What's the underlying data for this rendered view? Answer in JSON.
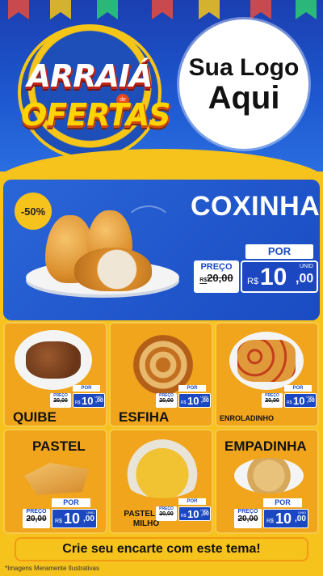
{
  "header": {
    "badge_line1": "ARRAIÁ",
    "badge_small": "de",
    "badge_line2": "OFERTAS",
    "logo_line1": "Sua Logo",
    "logo_line2": "Aqui"
  },
  "hero": {
    "discount": "-50%",
    "title": "COXINHA",
    "por": "POR",
    "preco_label": "PREÇO",
    "old_price": "20,00",
    "old_currency": "R$",
    "currency": "R$",
    "price_int": "10",
    "price_cents": ",00",
    "unit": "UNID"
  },
  "products": [
    {
      "name": "QUIBE",
      "preco": "PREÇO",
      "old": "20,00",
      "por": "POR",
      "currency": "R$",
      "int": "10",
      "cents": ",00",
      "unit": "UNID"
    },
    {
      "name": "ESFIHA",
      "preco": "PREÇO",
      "old": "20,00",
      "por": "POR",
      "currency": "R$",
      "int": "10",
      "cents": ",00",
      "unit": "UNID"
    },
    {
      "name": "ENROLADINHO",
      "preco": "PREÇO",
      "old": "20,00",
      "por": "POR",
      "currency": "R$",
      "int": "10",
      "cents": ",00",
      "unit": "UNID"
    },
    {
      "name": "PASTEL",
      "preco": "PREÇO",
      "old": "20,00",
      "por": "POR",
      "currency": "R$",
      "int": "10",
      "cents": ",00",
      "unit": "UNID"
    },
    {
      "name": "PASTEL DE MILHO",
      "preco": "PREÇO",
      "old": "20,00",
      "por": "POR",
      "currency": "R$",
      "int": "10",
      "cents": ",00",
      "unit": "UNID"
    },
    {
      "name": "EMPADINHA",
      "preco": "PREÇO",
      "old": "20,00",
      "por": "POR",
      "currency": "R$",
      "int": "10",
      "cents": ",00",
      "unit": "UNID"
    }
  ],
  "footer": {
    "cta": "Crie seu encarte com este tema!",
    "note": "*Imagens Meramente Ilustrativas"
  },
  "colors": {
    "blue": "#1b48c0",
    "yellow": "#f6c21c",
    "orange": "#f0a51c",
    "red": "#d8321f"
  }
}
